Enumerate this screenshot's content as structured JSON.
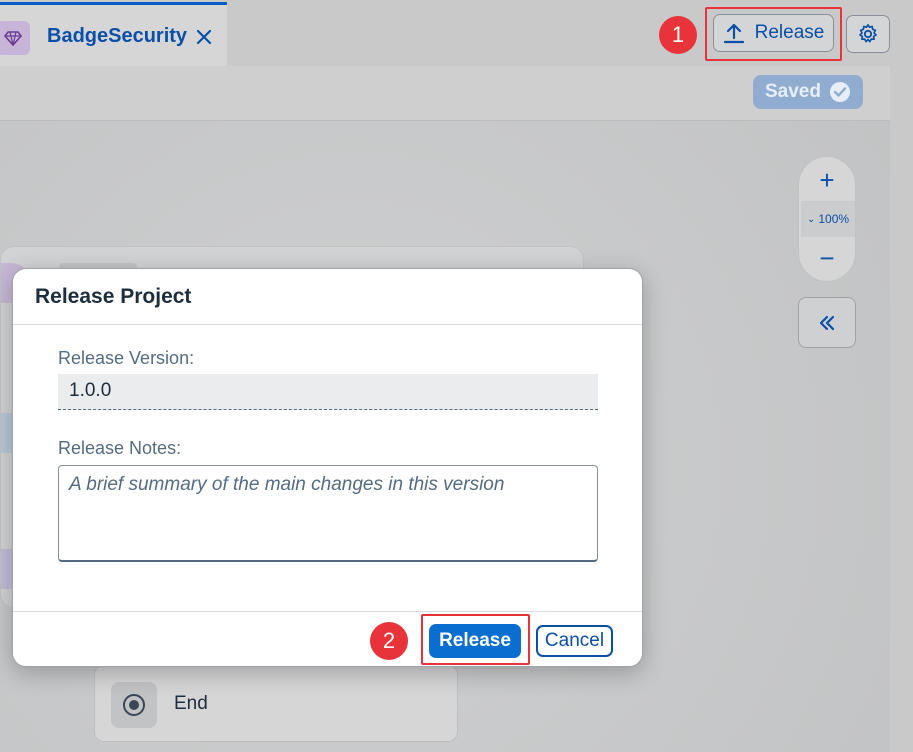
{
  "tab": {
    "label": "BadgeSecurity",
    "icon": "diamond-icon"
  },
  "toolbar": {
    "release_label": "Release",
    "saved_label": "Saved"
  },
  "zoom": {
    "level": "100%",
    "plus": "+",
    "minus": "−"
  },
  "end_node": {
    "label": "End"
  },
  "dialog": {
    "title": "Release Project",
    "version_label": "Release Version:",
    "version_value": "1.0.0",
    "notes_label": "Release Notes:",
    "notes_placeholder": "A brief summary of the main changes in this version",
    "release_button": "Release",
    "cancel_button": "Cancel"
  },
  "steps": {
    "one": "1",
    "two": "2"
  },
  "colors": {
    "accent": "#0a6ed1",
    "brand_dark": "#0a4fa8",
    "annotation": "#e8333a",
    "saved_bg": "#90acd0"
  }
}
